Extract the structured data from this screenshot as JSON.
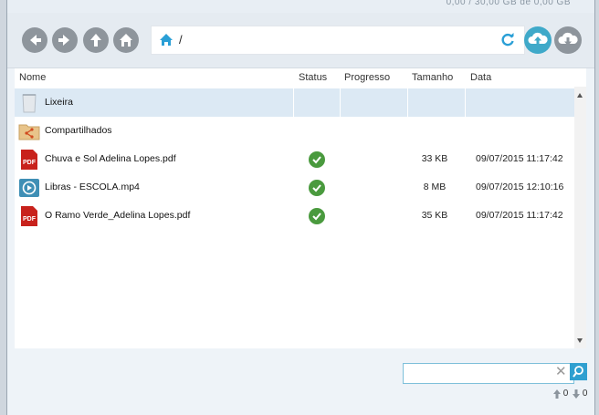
{
  "header": {
    "quota_text": "0,00 / 30,00 GB de 0,00 GB"
  },
  "nav": {
    "back_icon": "arrow-left-icon",
    "forward_icon": "arrow-right-icon",
    "up_icon": "arrow-up-icon",
    "home_icon": "home-icon"
  },
  "path": {
    "value": "/"
  },
  "actions": {
    "upload_icon": "cloud-upload-icon",
    "download_icon": "cloud-download-icon",
    "accent": "#3fa9c9"
  },
  "columns": {
    "name": "Nome",
    "status": "Status",
    "progress": "Progresso",
    "size": "Tamanho",
    "date": "Data"
  },
  "files": [
    {
      "name": "Lixeira",
      "icon": "trash-icon",
      "status": "",
      "size": "",
      "date": ""
    },
    {
      "name": "Compartilhados",
      "icon": "shared-folder-icon",
      "status": "",
      "size": "",
      "date": ""
    },
    {
      "name": "Chuva e Sol Adelina Lopes.pdf",
      "icon": "pdf-icon",
      "status": "ok",
      "size": "33 KB",
      "date": "09/07/2015 11:17:42"
    },
    {
      "name": "Libras - ESCOLA.mp4",
      "icon": "video-icon",
      "status": "ok",
      "size": "8 MB",
      "date": "09/07/2015 12:10:16"
    },
    {
      "name": "O Ramo Verde_Adelina Lopes.pdf",
      "icon": "pdf-icon",
      "status": "ok",
      "size": "35 KB",
      "date": "09/07/2015 11:17:42"
    }
  ],
  "search": {
    "value": "",
    "placeholder": ""
  },
  "transfer": {
    "uploads": "0",
    "downloads": "0"
  }
}
